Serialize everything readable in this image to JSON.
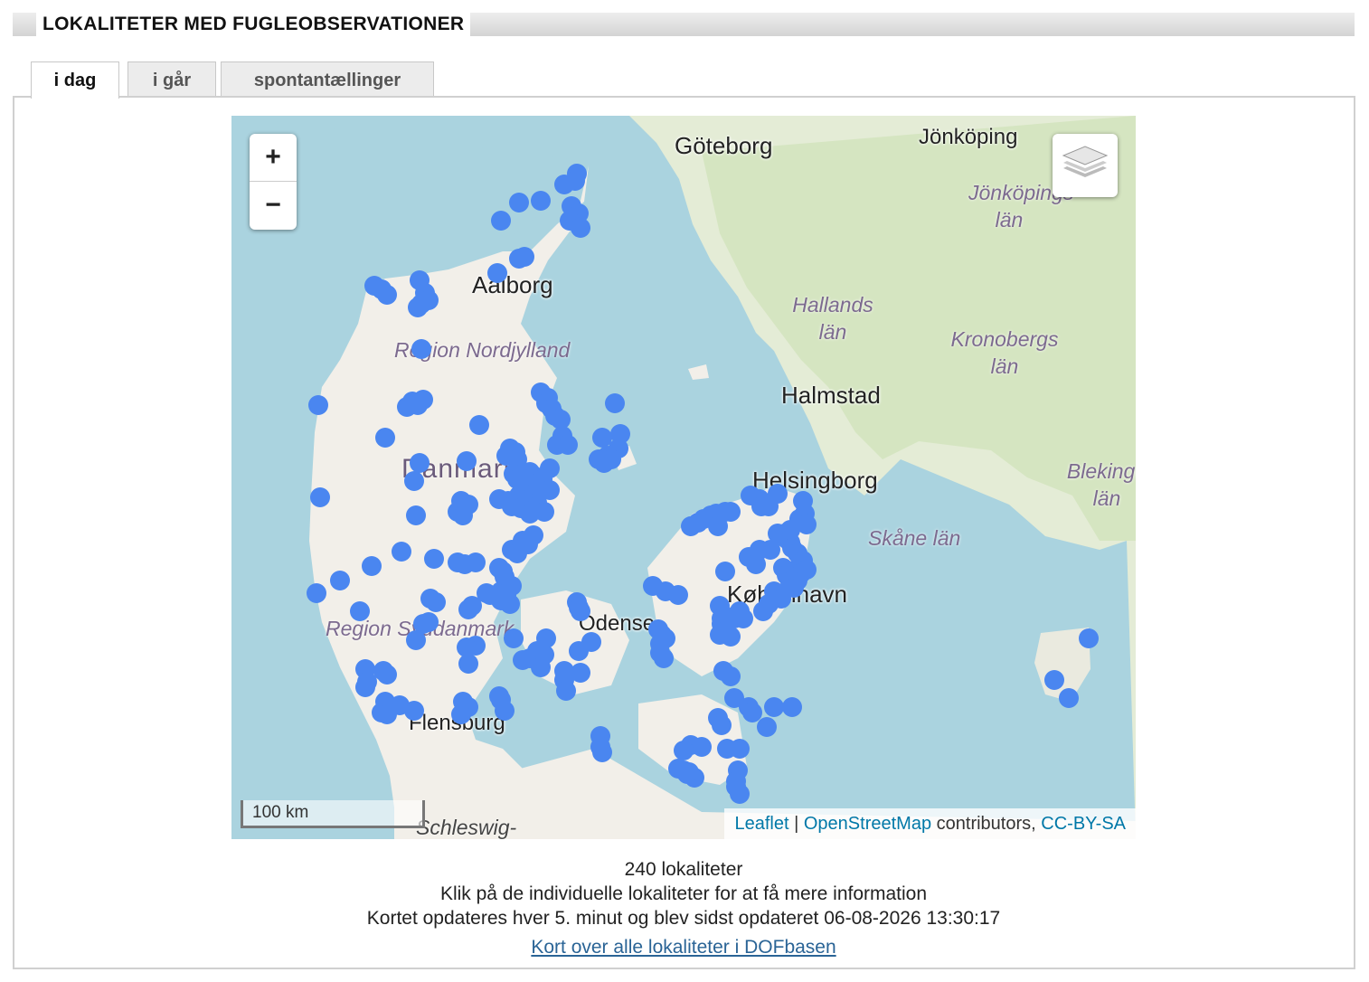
{
  "header": {
    "title": "LOKALITETER MED FUGLEOBSERVATIONER"
  },
  "tabs": [
    {
      "label": "i dag",
      "active": true
    },
    {
      "label": "i går",
      "active": false
    },
    {
      "label": "spontantællinger",
      "active": false
    }
  ],
  "map": {
    "zoom_in": "+",
    "zoom_out": "−",
    "scale": "100 km",
    "attribution": {
      "leaflet": "Leaflet",
      "sep": "|",
      "osm": "OpenStreetMap",
      "contributors": "contributors,",
      "license": "CC-BY-SA"
    },
    "labels": {
      "goteborg": "Göteborg",
      "jonkoping": "Jönköping",
      "jonkoping_lan": "Jönköpings län",
      "aalborg": "Aalborg",
      "nordjylland": "Region Nordjylland",
      "hallands": "Hallands län",
      "kronobergs": "Kronobergs län",
      "halmstad": "Halmstad",
      "danmark": "Danmark",
      "helsingborg": "Helsingborg",
      "blekinge": "Blekinge län",
      "skane": "Skåne län",
      "kobenhavn": "København",
      "syddanmark": "Region Syddanmark",
      "odense": "Odense",
      "flensburg": "Flensburg",
      "schleswig": "Schleswig-"
    },
    "marker_color": "#4a86f0",
    "water_color": "#aad3df",
    "land_color": "#f2efe9"
  },
  "footer": {
    "count": "240 lokaliteter",
    "hint": "Klik på de individuelle lokaliteter for at få mere information",
    "updated": "Kortet opdateres hver 5. minut og blev sidst opdateret 06-08-2026 13:30:17",
    "link": "Kort over alle lokaliteter i DOFbasen"
  }
}
